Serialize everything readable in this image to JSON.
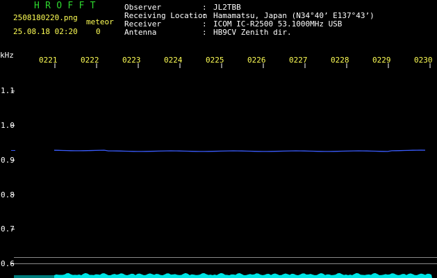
{
  "header": {
    "app_title": "HROFFT",
    "file_name": "2508180220.png",
    "timestamp": "25.08.18 02:20",
    "meteor_label": "meteor",
    "meteor_count": "0"
  },
  "station_info": [
    {
      "label": "Observer",
      "value": "JL2TBB"
    },
    {
      "label": "Receiving Location",
      "value": "Hamamatsu, Japan (N34°40’ E137°43’)"
    },
    {
      "label": "Receiver",
      "value": "ICOM IC-R2500 53.1000MHz USB"
    },
    {
      "label": "Antenna",
      "value": "HB9CV Zenith dir."
    }
  ],
  "plot": {
    "unit_label": "kHz",
    "time_ticks": [
      "0221",
      "0222",
      "0223",
      "0224",
      "0225",
      "0226",
      "0227",
      "0228",
      "0229",
      "0230"
    ],
    "freq_ticks": [
      "1.1",
      "1.0",
      "0.9",
      "0.8",
      "0.7",
      "0.6"
    ],
    "freq_values": [
      1.1,
      1.0,
      0.9,
      0.8,
      0.7,
      0.6
    ],
    "carrier_khz": 0.928,
    "reference_lines_khz": [
      0.618,
      0.6
    ],
    "colors": {
      "text_yellow": "#ffff55",
      "title_green": "#2ed82e",
      "carrier_blue": "#3a5cff",
      "noise_cyan": "#00e5e5",
      "tick_white": "#ffffff",
      "reference_gray": "#8a8a8a"
    }
  }
}
